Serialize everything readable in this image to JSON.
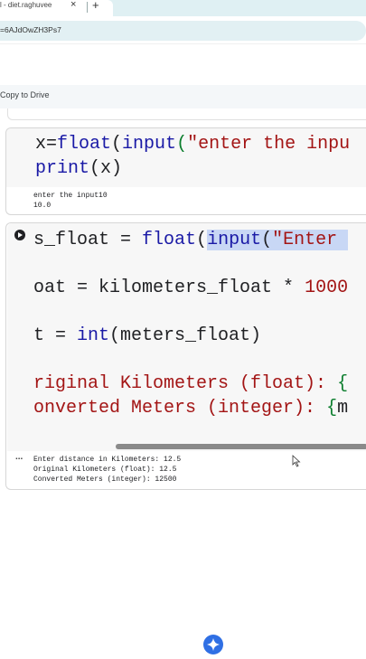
{
  "browser": {
    "tab_title": "l - diet.raghuvee",
    "close_glyph": "×",
    "new_tab_glyph": "+",
    "url_fragment": "=6AJdOwZH3Ps7"
  },
  "toolbar": {
    "copy_to_drive": "Copy to Drive"
  },
  "cell1": {
    "code_lines": [
      {
        "parts": [
          {
            "t": "x=",
            "c": ""
          },
          {
            "t": "float",
            "c": "kw-blue"
          },
          {
            "t": "(",
            "c": ""
          },
          {
            "t": "input",
            "c": "kw-blue"
          },
          {
            "t": "(",
            "c": "kw-green"
          },
          {
            "t": "\"enter the inpu",
            "c": "kw-red"
          }
        ]
      },
      {
        "parts": [
          {
            "t": "print",
            "c": "kw-blue"
          },
          {
            "t": "(x)",
            "c": ""
          }
        ]
      }
    ],
    "output": [
      "enter the input10",
      "10.0"
    ]
  },
  "cell2": {
    "code_lines": [
      {
        "parts": [
          {
            "t": "s_float = ",
            "c": ""
          },
          {
            "t": "float",
            "c": "kw-blue"
          },
          {
            "t": "(",
            "c": ""
          },
          {
            "t": "input",
            "c": "kw-blue sel"
          },
          {
            "t": "(",
            "c": "sel"
          },
          {
            "t": "\"Enter ",
            "c": "kw-red sel"
          }
        ]
      },
      {
        "parts": [
          {
            "t": "oat = kilometers_float * ",
            "c": ""
          },
          {
            "t": "1000",
            "c": "kw-red"
          }
        ]
      },
      {
        "parts": [
          {
            "t": "t = ",
            "c": ""
          },
          {
            "t": "int",
            "c": "kw-blue"
          },
          {
            "t": "(meters_float)",
            "c": ""
          }
        ]
      },
      {
        "parts": [
          {
            "t": "riginal Kilometers (float): ",
            "c": "kw-red"
          },
          {
            "t": "{",
            "c": "kw-green"
          }
        ]
      },
      {
        "parts": [
          {
            "t": "onverted Meters (integer): ",
            "c": "kw-red"
          },
          {
            "t": "{",
            "c": "kw-green"
          },
          {
            "t": "m",
            "c": ""
          }
        ]
      }
    ],
    "output": [
      "Enter distance in Kilometers: 12.5",
      "Original Kilometers (float): 12.5",
      "Converted Meters (integer): 12500"
    ],
    "output_menu": "..."
  }
}
